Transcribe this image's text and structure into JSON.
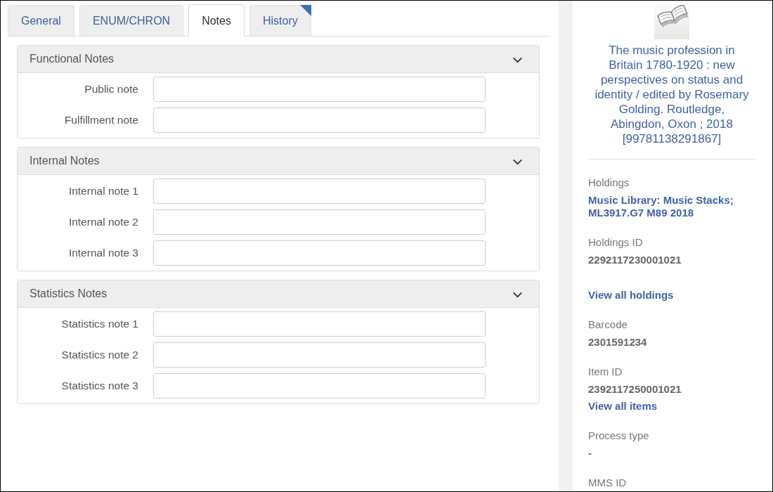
{
  "tabs": [
    {
      "label": "General",
      "selected": false,
      "flagged": false
    },
    {
      "label": "ENUM/CHRON",
      "selected": false,
      "flagged": false
    },
    {
      "label": "Notes",
      "selected": true,
      "flagged": false
    },
    {
      "label": "History",
      "selected": false,
      "flagged": true
    }
  ],
  "sections": [
    {
      "title": "Functional Notes",
      "expanded": true,
      "fields": [
        {
          "label": "Public note"
        },
        {
          "label": "Fulfillment note"
        }
      ]
    },
    {
      "title": "Internal Notes",
      "expanded": true,
      "fields": [
        {
          "label": "Internal note 1"
        },
        {
          "label": "Internal note 2"
        },
        {
          "label": "Internal note 3"
        }
      ]
    },
    {
      "title": "Statistics Notes",
      "expanded": true,
      "fields": [
        {
          "label": "Statistics note 1"
        },
        {
          "label": "Statistics note 2"
        },
        {
          "label": "Statistics note 3"
        }
      ]
    }
  ],
  "record": {
    "title": "The music profession in Britain 1780-1920 : new perspectives on status and identity / edited by Rosemary Golding. Routledge, Abingdon, Oxon ; 2018 [99781138291867]",
    "details": [
      {
        "label": "Holdings",
        "value": "Music Library: Music Stacks; ML3917.G7 M89 2018",
        "kind": "link"
      },
      {
        "label": "Holdings ID",
        "value": "2292117230001021",
        "kind": "text"
      },
      {
        "link": "View all holdings"
      },
      {
        "label": "Barcode",
        "value": "2301591234",
        "kind": "text"
      },
      {
        "label": "Item ID",
        "value": "2392117250001021",
        "kind": "text",
        "link": "View all items"
      },
      {
        "label": "Process type",
        "value": "-",
        "kind": "text"
      },
      {
        "label": "MMS ID"
      }
    ]
  }
}
